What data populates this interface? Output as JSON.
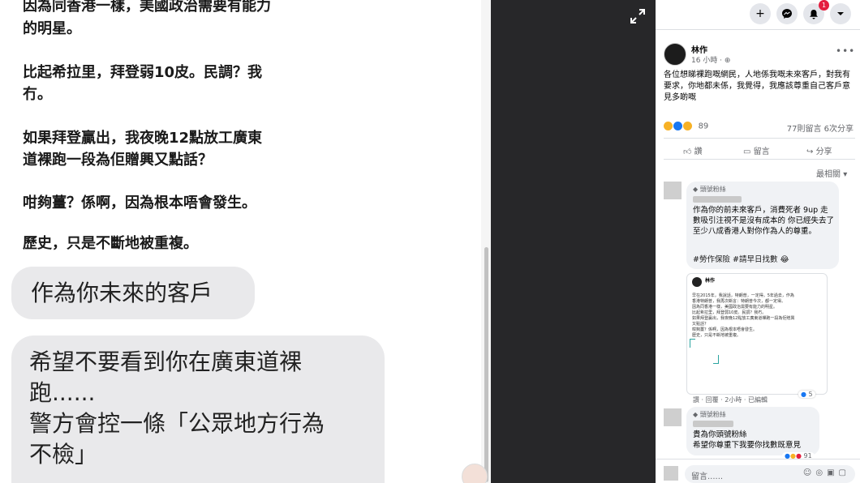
{
  "left_post": {
    "lines": [
      "因為同香港一樣，美國政治需要有能力",
      "的明星。",
      "比起希拉里，拜登弱10皮。民調？我",
      "冇。",
      "如果拜登贏出，我夜晚12點放工廣東",
      "道裸跑一段為佢贈興又點話？",
      "咁夠薑？係啊，因為根本唔會發生。",
      "歷史，只是不斷地被重複。"
    ]
  },
  "chat": {
    "bubble1": "作為你未來的客戶",
    "bubble2_lines": [
      "希望不要看到你在廣東道裸",
      "跑......",
      "警方會控一條「公眾地方行為",
      "不檢」"
    ]
  },
  "viewer": {
    "expand_icon": "expand-icon"
  },
  "facebook": {
    "topbar": {
      "plus": "+",
      "notif_count": "1"
    },
    "post": {
      "author": "林作",
      "time": "16 小時 · ",
      "caption": "各位想睇裸跑嘅網民，人地係我嘅未來客戶，對我有要求，你地都未係，我覺得，我應該尊重自己客戶意見多啲嘅",
      "reaction_count": "89",
      "comments_shares": "77則留言  6次分享",
      "actions": {
        "like": "讚",
        "comment": "留言",
        "share": "分享"
      },
      "sort": "最相關"
    },
    "comment1": {
      "badge": "頭號粉絲",
      "text": "作為你的前未來客戶，消費死者 9up 走數吸引注視不是沒有成本的 你已經失去了至少八成香港人對你作為人的尊重。",
      "tags": "#勞作保險 #請早日找數 ",
      "meta": "讚 · 回覆 · 2小時 · 已編輯",
      "likes": "5"
    },
    "embedded_shot": {
      "author": "林作",
      "lines": [
        "早在2015年，我說話，特朗普，一定得。5年過去，作為",
        "香港特朗普，我再次斷言：特朗普今次，都一定得。",
        "",
        "因為同香港一樣，美國政治需要有能力的明星。",
        "",
        "比起希拉里，拜登弱10皮。民調？我冇。",
        "",
        "如果拜登贏出，我夜晚12點放工廣東道裸跑一段為佢贈興",
        "又點話？",
        "",
        "咁夠薑？係啊，因為根本唔會發生。",
        "",
        "歷史，只是不斷地被重複。"
      ]
    },
    "comment2": {
      "badge": "頭號粉絲",
      "line1": "貴為你頭號粉絲",
      "line2": "希望你尊重下我要你找數既意見",
      "likes": "91"
    },
    "composer": {
      "placeholder": "留言......"
    }
  }
}
